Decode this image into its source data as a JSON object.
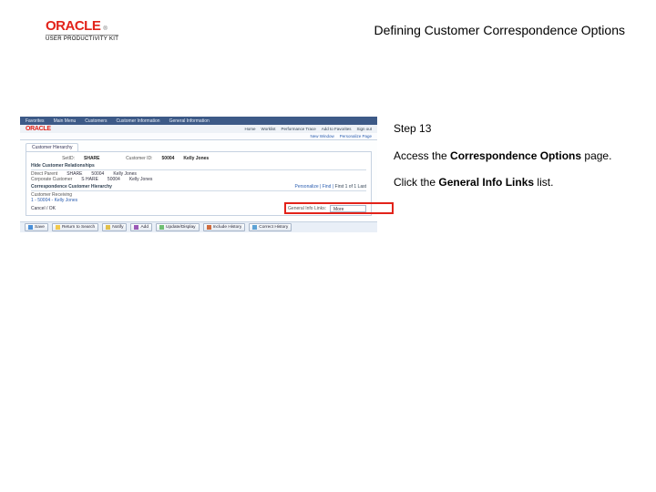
{
  "header": {
    "logo_text": "ORACLE",
    "logo_tm": "®",
    "subline": "USER PRODUCTIVITY KIT",
    "title": "Defining Customer Correspondence Options"
  },
  "instructions": {
    "step_label": "Step 13",
    "line1_a": "Access the ",
    "line1_bold": "Correspondence Options",
    "line1_b": " page.",
    "line2_a": "Click the ",
    "line2_bold": "General Info Links",
    "line2_b": " list."
  },
  "screenshot": {
    "topnav": [
      "Favorites",
      "Main Menu",
      "Customers",
      "Customer Information",
      "General Information"
    ],
    "brand": "ORACLE",
    "brand_links": [
      "Home",
      "Worklist",
      "Performance Trace",
      "Add to Favorites",
      "Sign out"
    ],
    "subline_links": [
      "New Window",
      "Personalize Page"
    ],
    "tab": "Customer Hierarchy",
    "row1": {
      "setid_label": "SetID:",
      "setid_value": "SHARE",
      "custid_label": "Customer ID:",
      "custid_value": "50004",
      "name_label": "",
      "name_value": "Kelly Jones"
    },
    "sec1": "Hide Customer Relationships",
    "rel": {
      "parent_lab": "Direct Parent",
      "parent_val": "SHARE",
      "parentid_lab": "",
      "parentid_val": "50004",
      "parentname": "Kelly Jones",
      "corp_lab": "Corporate Customer",
      "corp_val": "S HARE",
      "corpid_val": "50004",
      "corpname": "Kelly Jones"
    },
    "sec2": "Correspondence Customer Hierarchy",
    "sec2_right": "Personalize | Find |",
    "sec2_count": "First 1 of 1 Last",
    "cust_recvr": "Customer Receiving",
    "row_link": "1 - 50004 - Kelly Jones",
    "correl": "Cancel / OK",
    "gi_label": "General Info Links:",
    "gi_value": "More",
    "buttons": [
      "Save",
      "Return to Search",
      "Notify",
      "Add",
      "Update/Display",
      "Include History",
      "Correct History"
    ]
  }
}
